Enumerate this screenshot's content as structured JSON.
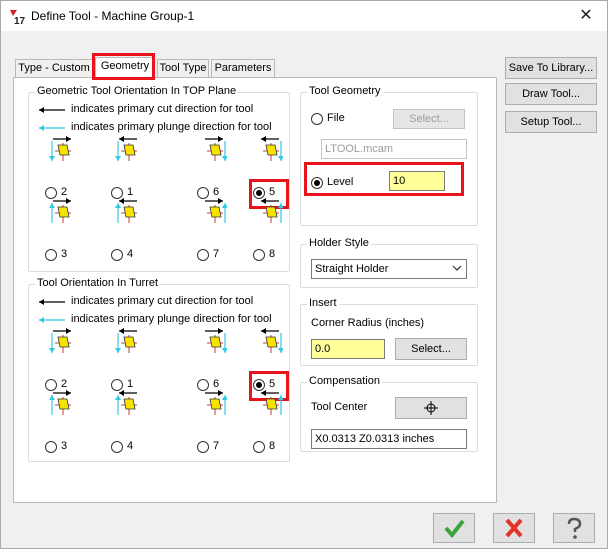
{
  "window": {
    "title": "Define Tool - Machine Group-1",
    "logo_text": "17",
    "close_label": "✕"
  },
  "tabs": [
    {
      "label": "Type - Custom"
    },
    {
      "label": "Geometry"
    },
    {
      "label": "Tool Type"
    },
    {
      "label": "Parameters"
    }
  ],
  "side_buttons": {
    "save": "Save To Library...",
    "draw": "Draw Tool...",
    "setup": "Setup Tool..."
  },
  "top_plane": {
    "title": "Geometric Tool Orientation In TOP Plane",
    "legend_cut": "indicates primary cut direction for tool",
    "legend_plunge": "indicates primary plunge direction for tool",
    "options": [
      "2",
      "1",
      "6",
      "5",
      "3",
      "4",
      "7",
      "8"
    ],
    "selected": "5"
  },
  "turret": {
    "title": "Tool Orientation In Turret",
    "legend_cut": "indicates primary cut direction for tool",
    "legend_plunge": "indicates primary plunge direction for tool",
    "options": [
      "2",
      "1",
      "6",
      "5",
      "3",
      "4",
      "7",
      "8"
    ],
    "selected": "5"
  },
  "tool_geometry": {
    "title": "Tool Geometry",
    "file_label": "File",
    "select_label": "Select...",
    "file_value": "LTOOL.mcam",
    "level_label": "Level",
    "level_value": "10"
  },
  "holder": {
    "title": "Holder Style",
    "value": "Straight Holder"
  },
  "insert": {
    "title": "Insert",
    "corner_label": "Corner Radius (inches)",
    "corner_value": "0.0",
    "select_label": "Select..."
  },
  "compensation": {
    "title": "Compensation",
    "tool_center_label": "Tool Center",
    "coords": "X0.0313 Z0.0313 inches"
  },
  "colors": {
    "accent_red": "#e8131b",
    "cut_arrow": "#000000",
    "plunge_arrow": "#33c7e8",
    "insert_yellow": "#f5e400",
    "ok_green": "#3aa63a",
    "cancel_red": "#e2342a"
  }
}
